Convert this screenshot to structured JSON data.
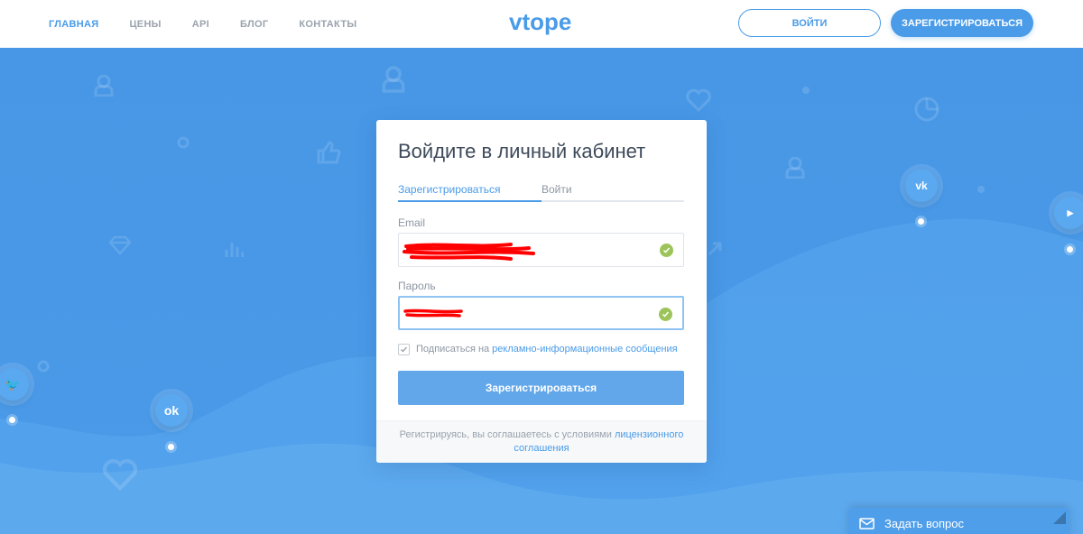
{
  "nav": {
    "items": [
      {
        "label": "ГЛАВНАЯ",
        "active": true
      },
      {
        "label": "ЦЕНЫ"
      },
      {
        "label": "API"
      },
      {
        "label": "БЛОГ"
      },
      {
        "label": "КОНТАКТЫ"
      }
    ]
  },
  "logo": {
    "text": "vtope"
  },
  "header": {
    "login_label": "ВОЙТИ",
    "register_label": "ЗАРЕГИСТРИРОВАТЬСЯ"
  },
  "card": {
    "title": "Войдите в личный кабинет",
    "tabs": [
      {
        "label": "Зарегистрироваться",
        "active": true
      },
      {
        "label": "Войти"
      }
    ],
    "email_label": "Email",
    "email_value": "",
    "password_label": "Пароль",
    "password_value": "",
    "consent_text": "Подписаться на",
    "consent_link": "рекламно-информационные сообщения",
    "consent_checked": true,
    "submit_label": "Зарегистрироваться",
    "footer_text": "Регистрируясь, вы соглашаетесь с условиями",
    "footer_link": "лицензионного соглашения"
  },
  "social": {
    "vk": "vk-icon",
    "youtube": "youtube-icon",
    "twitter": "twitter-icon",
    "odnoklassniki": "odnoklassniki-icon"
  },
  "chat": {
    "label": "Задать вопрос"
  },
  "colors": {
    "accent": "#4a9be8",
    "success": "#9cc45a",
    "text_dark": "#3e4a5a",
    "text_muted": "#8c96a2"
  }
}
